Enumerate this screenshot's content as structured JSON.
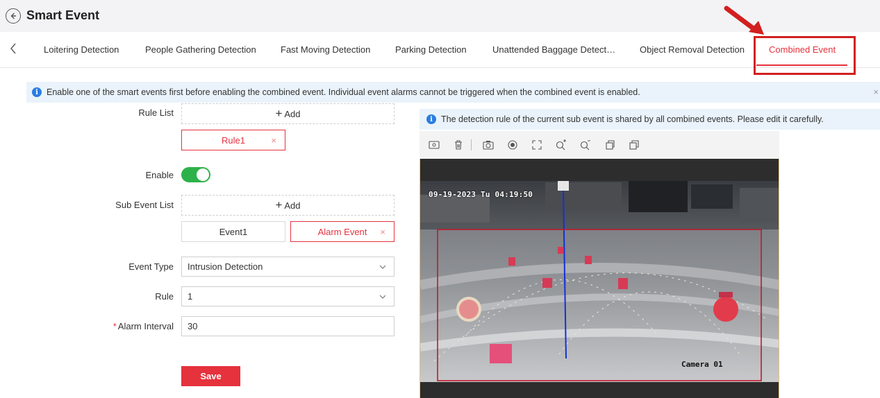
{
  "header": {
    "title": "Smart Event"
  },
  "tabs": [
    {
      "label": "Loitering Detection",
      "active": false
    },
    {
      "label": "People Gathering Detection",
      "active": false
    },
    {
      "label": "Fast Moving Detection",
      "active": false
    },
    {
      "label": "Parking Detection",
      "active": false
    },
    {
      "label": "Unattended Baggage Detect…",
      "active": false
    },
    {
      "label": "Object Removal Detection",
      "active": false
    },
    {
      "label": "Combined Event",
      "active": true
    }
  ],
  "notice": {
    "text": "Enable one of the smart events first before enabling the combined event. Individual event alarms cannot be triggered when the combined event is enabled.",
    "close": "×"
  },
  "form": {
    "rule_list_label": "Rule List",
    "add_label": "Add",
    "rules": [
      {
        "label": "Rule1",
        "selected": true
      }
    ],
    "enable_label": "Enable",
    "enable_value": true,
    "sub_event_list_label": "Sub Event List",
    "sub_events": [
      {
        "label": "Event1",
        "selected": false
      },
      {
        "label": "Alarm Event",
        "selected": true
      }
    ],
    "event_type_label": "Event Type",
    "event_type_value": "Intrusion Detection",
    "rule_label": "Rule",
    "rule_value": "1",
    "alarm_interval_required": "*",
    "alarm_interval_label": "Alarm Interval",
    "alarm_interval_value": "30",
    "save_label": "Save"
  },
  "right_notice": {
    "text": "The detection rule of the current sub event is shared by all combined events. Please edit it carefully."
  },
  "toolbar": {
    "tools": [
      "capture-frame-icon",
      "delete-icon",
      "camera-icon",
      "record-icon",
      "fullscreen-icon",
      "zoom-in-icon",
      "zoom-out-icon",
      "window-icon",
      "window-restore-icon"
    ]
  },
  "video": {
    "timestamp": "09-19-2023 Tu  04:19:50",
    "camera_name": "Camera 01"
  },
  "colors": {
    "accent_red": "#e5323d",
    "toggle_green": "#2db24a",
    "info_blue": "#2a7de1",
    "notice_bg": "#eaf3fb"
  }
}
